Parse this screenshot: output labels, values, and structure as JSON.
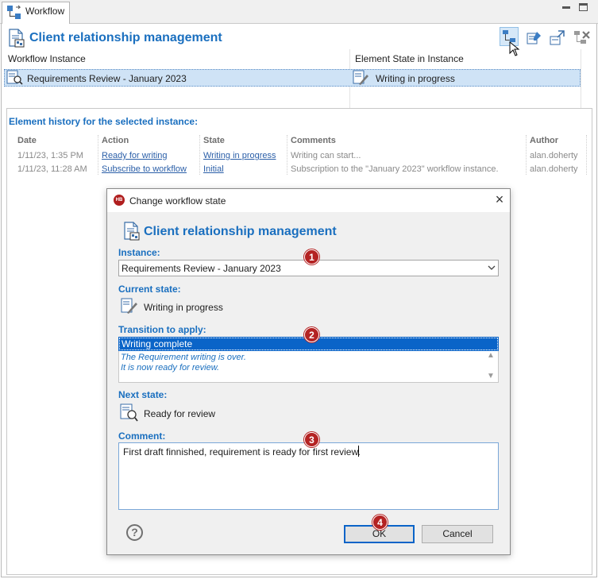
{
  "view": {
    "tab_label": "Workflow",
    "title": "Client relationship management",
    "columns": {
      "instance": "Workflow Instance",
      "state": "Element State in Instance"
    },
    "selected_row": {
      "instance": "Requirements Review - January 2023",
      "state": "Writing in progress"
    }
  },
  "history": {
    "title": "Element history for the selected instance:",
    "headers": {
      "date": "Date",
      "action": "Action",
      "state": "State",
      "comments": "Comments",
      "author": "Author"
    },
    "rows": [
      {
        "date": "1/11/23, 1:35 PM",
        "action": "Ready for writing",
        "state": "Writing in progress",
        "comments": "Writing can start...",
        "author": "alan.doherty"
      },
      {
        "date": "1/11/23, 11:28 AM",
        "action": "Subscribe to workflow",
        "state": "Initial",
        "comments": "Subscription to the \"January 2023\" workflow instance.",
        "author": "alan.doherty"
      }
    ]
  },
  "dialog": {
    "title": "Change workflow state",
    "app_icon_text": "HB",
    "heading": "Client relationship management",
    "instance_label": "Instance:",
    "instance_value": "Requirements Review - January 2023",
    "current_state_label": "Current state:",
    "current_state_value": "Writing in progress",
    "transition_label": "Transition to apply:",
    "transition_option": "Writing complete",
    "transition_desc_1": "The Requirement writing is over.",
    "transition_desc_2": "It is now ready for review.",
    "next_state_label": "Next state:",
    "next_state_value": "Ready for review",
    "comment_label": "Comment:",
    "comment_value": "First draft finnished, requirement is ready for first review.",
    "help_label": "?",
    "ok_label": "OK",
    "cancel_label": "Cancel"
  },
  "callouts": [
    "1",
    "2",
    "3",
    "4"
  ],
  "colors": {
    "accent": "#1a6fbf",
    "selection": "#0a64c8",
    "row_highlight": "#cfe3f6",
    "callout": "#b42323"
  }
}
